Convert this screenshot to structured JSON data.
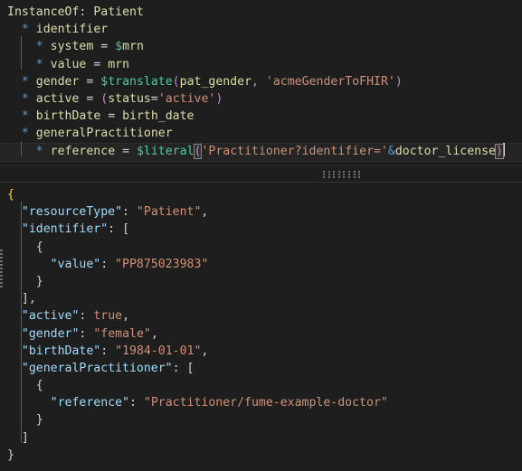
{
  "theme": {
    "editor_background": "#1e1e1e",
    "active_line_background": "#242424",
    "splitter_background": "#1e1e1e",
    "indent_guide": "#5a5a5a",
    "bracket_match_border": "#888888",
    "caret": "#d4d4d4",
    "colors": {
      "keyword_yellow": "#dcdcaa",
      "function_green": "#4ec9a0",
      "string_orange": "#ce9178",
      "bullet_blue": "#569cd6",
      "paren_purple": "#c586c0",
      "json_key_blue": "#9cdcfe",
      "plain_text": "#d4d4d4",
      "bracket_gold": "#ffd700"
    }
  },
  "mapping_editor": {
    "name": "fume-mapping-editor",
    "language": "FHIR Shorthand mapping",
    "lines": [
      {
        "indent": 0,
        "active": false,
        "tokens": [
          {
            "text": "InstanceOf",
            "cls": "t-keyword"
          },
          {
            "text": ":",
            "cls": "t-plain"
          },
          {
            "text": " ",
            "cls": "t-plain"
          },
          {
            "text": "Patient",
            "cls": "t-keyword"
          }
        ]
      },
      {
        "indent": 0,
        "active": false,
        "tokens": [
          {
            "text": "  ",
            "cls": "t-plain"
          },
          {
            "text": "*",
            "cls": "t-star"
          },
          {
            "text": " ",
            "cls": "t-plain"
          },
          {
            "text": "identifier",
            "cls": "t-prop"
          }
        ]
      },
      {
        "indent": 1,
        "active": false,
        "tokens": [
          {
            "text": "    ",
            "cls": "t-plain"
          },
          {
            "text": "*",
            "cls": "t-star"
          },
          {
            "text": " ",
            "cls": "t-plain"
          },
          {
            "text": "system",
            "cls": "t-prop"
          },
          {
            "text": " = ",
            "cls": "t-plain"
          },
          {
            "text": "$",
            "cls": "t-func"
          },
          {
            "text": "mrn",
            "cls": "t-var"
          }
        ]
      },
      {
        "indent": 1,
        "active": false,
        "tokens": [
          {
            "text": "    ",
            "cls": "t-plain"
          },
          {
            "text": "*",
            "cls": "t-star"
          },
          {
            "text": " ",
            "cls": "t-plain"
          },
          {
            "text": "value",
            "cls": "t-prop"
          },
          {
            "text": " = ",
            "cls": "t-plain"
          },
          {
            "text": "mrn",
            "cls": "t-var"
          }
        ]
      },
      {
        "indent": 0,
        "active": false,
        "tokens": [
          {
            "text": "  ",
            "cls": "t-plain"
          },
          {
            "text": "*",
            "cls": "t-star"
          },
          {
            "text": " ",
            "cls": "t-plain"
          },
          {
            "text": "gender",
            "cls": "t-prop"
          },
          {
            "text": " = ",
            "cls": "t-plain"
          },
          {
            "text": "$translate",
            "cls": "t-func"
          },
          {
            "text": "(",
            "cls": "t-punct"
          },
          {
            "text": "pat_gender",
            "cls": "t-var"
          },
          {
            "text": ", ",
            "cls": "t-punct"
          },
          {
            "text": "'acmeGenderToFHIR'",
            "cls": "t-str"
          },
          {
            "text": ")",
            "cls": "t-punct"
          }
        ]
      },
      {
        "indent": 0,
        "active": false,
        "tokens": [
          {
            "text": "  ",
            "cls": "t-plain"
          },
          {
            "text": "*",
            "cls": "t-star"
          },
          {
            "text": " ",
            "cls": "t-plain"
          },
          {
            "text": "active",
            "cls": "t-prop"
          },
          {
            "text": " = ",
            "cls": "t-plain"
          },
          {
            "text": "(",
            "cls": "t-punct"
          },
          {
            "text": "status",
            "cls": "t-var"
          },
          {
            "text": "=",
            "cls": "t-plain"
          },
          {
            "text": "'active'",
            "cls": "t-str"
          },
          {
            "text": ")",
            "cls": "t-punct"
          }
        ]
      },
      {
        "indent": 0,
        "active": false,
        "tokens": [
          {
            "text": "  ",
            "cls": "t-plain"
          },
          {
            "text": "*",
            "cls": "t-star"
          },
          {
            "text": " ",
            "cls": "t-plain"
          },
          {
            "text": "birthDate",
            "cls": "t-prop"
          },
          {
            "text": " = ",
            "cls": "t-plain"
          },
          {
            "text": "birth_date",
            "cls": "t-var"
          }
        ]
      },
      {
        "indent": 0,
        "active": false,
        "tokens": [
          {
            "text": "  ",
            "cls": "t-plain"
          },
          {
            "text": "*",
            "cls": "t-star"
          },
          {
            "text": " ",
            "cls": "t-plain"
          },
          {
            "text": "generalPractitioner",
            "cls": "t-prop"
          }
        ]
      },
      {
        "indent": 1,
        "active": true,
        "tokens": [
          {
            "text": "    ",
            "cls": "t-plain"
          },
          {
            "text": "*",
            "cls": "t-star"
          },
          {
            "text": " ",
            "cls": "t-plain"
          },
          {
            "text": "reference",
            "cls": "t-prop"
          },
          {
            "text": " = ",
            "cls": "t-plain"
          },
          {
            "text": "$literal",
            "cls": "t-func"
          },
          {
            "text": "(",
            "cls": "t-punct",
            "bracket_match": true
          },
          {
            "text": "'Practitioner?identifier='",
            "cls": "t-str"
          },
          {
            "text": "&",
            "cls": "t-amp"
          },
          {
            "text": "doctor_license",
            "cls": "t-var"
          },
          {
            "text": ")",
            "cls": "t-punct",
            "bracket_match": true
          },
          {
            "caret": true
          }
        ]
      }
    ]
  },
  "json_output": {
    "name": "fume-json-output",
    "language": "json",
    "lines": [
      {
        "indent": 0,
        "tokens": [
          {
            "text": "{",
            "cls": "t-brace-o"
          }
        ]
      },
      {
        "indent": 1,
        "tokens": [
          {
            "text": "  ",
            "cls": "t-plain"
          },
          {
            "text": "\"resourceType\"",
            "cls": "t-key"
          },
          {
            "text": ": ",
            "cls": "t-plain"
          },
          {
            "text": "\"Patient\"",
            "cls": "t-val"
          },
          {
            "text": ",",
            "cls": "t-comma"
          }
        ]
      },
      {
        "indent": 1,
        "tokens": [
          {
            "text": "  ",
            "cls": "t-plain"
          },
          {
            "text": "\"identifier\"",
            "cls": "t-key"
          },
          {
            "text": ": ",
            "cls": "t-plain"
          },
          {
            "text": "[",
            "cls": "t-brack"
          }
        ]
      },
      {
        "indent": 2,
        "tokens": [
          {
            "text": "    ",
            "cls": "t-plain"
          },
          {
            "text": "{",
            "cls": "t-brace"
          }
        ]
      },
      {
        "indent": 3,
        "tokens": [
          {
            "text": "      ",
            "cls": "t-plain"
          },
          {
            "text": "\"value\"",
            "cls": "t-key"
          },
          {
            "text": ": ",
            "cls": "t-plain"
          },
          {
            "text": "\"PP875023983\"",
            "cls": "t-val"
          }
        ]
      },
      {
        "indent": 2,
        "tokens": [
          {
            "text": "    ",
            "cls": "t-plain"
          },
          {
            "text": "}",
            "cls": "t-brace"
          }
        ]
      },
      {
        "indent": 1,
        "tokens": [
          {
            "text": "  ",
            "cls": "t-plain"
          },
          {
            "text": "]",
            "cls": "t-brack"
          },
          {
            "text": ",",
            "cls": "t-comma"
          }
        ]
      },
      {
        "indent": 1,
        "tokens": [
          {
            "text": "  ",
            "cls": "t-plain"
          },
          {
            "text": "\"active\"",
            "cls": "t-key"
          },
          {
            "text": ": ",
            "cls": "t-plain"
          },
          {
            "text": "true",
            "cls": "t-val"
          },
          {
            "text": ",",
            "cls": "t-comma"
          }
        ]
      },
      {
        "indent": 1,
        "tokens": [
          {
            "text": "  ",
            "cls": "t-plain"
          },
          {
            "text": "\"gender\"",
            "cls": "t-key"
          },
          {
            "text": ": ",
            "cls": "t-plain"
          },
          {
            "text": "\"female\"",
            "cls": "t-val"
          },
          {
            "text": ",",
            "cls": "t-comma"
          }
        ]
      },
      {
        "indent": 1,
        "tokens": [
          {
            "text": "  ",
            "cls": "t-plain"
          },
          {
            "text": "\"birthDate\"",
            "cls": "t-key"
          },
          {
            "text": ": ",
            "cls": "t-plain"
          },
          {
            "text": "\"1984-01-01\"",
            "cls": "t-val"
          },
          {
            "text": ",",
            "cls": "t-comma"
          }
        ]
      },
      {
        "indent": 1,
        "tokens": [
          {
            "text": "  ",
            "cls": "t-plain"
          },
          {
            "text": "\"generalPractitioner\"",
            "cls": "t-key"
          },
          {
            "text": ": ",
            "cls": "t-plain"
          },
          {
            "text": "[",
            "cls": "t-brack"
          }
        ]
      },
      {
        "indent": 2,
        "tokens": [
          {
            "text": "    ",
            "cls": "t-plain"
          },
          {
            "text": "{",
            "cls": "t-brace"
          }
        ]
      },
      {
        "indent": 3,
        "tokens": [
          {
            "text": "      ",
            "cls": "t-plain"
          },
          {
            "text": "\"reference\"",
            "cls": "t-key"
          },
          {
            "text": ": ",
            "cls": "t-plain"
          },
          {
            "text": "\"Practitioner/fume-example-doctor\"",
            "cls": "t-val"
          }
        ]
      },
      {
        "indent": 2,
        "tokens": [
          {
            "text": "    ",
            "cls": "t-plain"
          },
          {
            "text": "}",
            "cls": "t-brace"
          }
        ]
      },
      {
        "indent": 1,
        "tokens": [
          {
            "text": "  ",
            "cls": "t-plain"
          },
          {
            "text": "]",
            "cls": "t-brack"
          }
        ]
      },
      {
        "indent": 0,
        "tokens": [
          {
            "text": "}",
            "cls": "t-brace"
          }
        ]
      }
    ]
  },
  "controls": {
    "splitter": {
      "name": "horizontal-splitter",
      "handle": "resize-grip-dots"
    },
    "left_handle": {
      "name": "vertical-resize-handle",
      "handle": "resize-grip-dots"
    }
  }
}
